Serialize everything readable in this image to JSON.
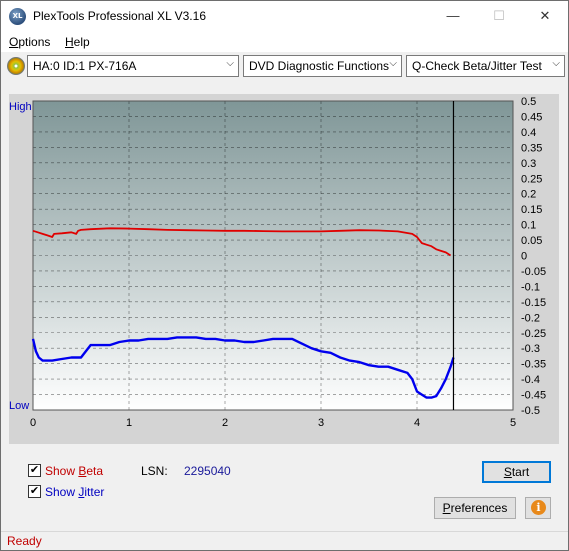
{
  "window": {
    "title": "PlexTools Professional XL V3.16",
    "icon_text": "XL",
    "minimize": "—",
    "maximize": "☐",
    "close": "✕"
  },
  "menu": [
    {
      "label": "Options",
      "accel": "O"
    },
    {
      "label": "Help",
      "accel": "H"
    }
  ],
  "toolbar": {
    "drive": "HA:0 ID:1  PX-716A",
    "function": "DVD Diagnostic Functions",
    "test": "Q-Check Beta/Jitter Test"
  },
  "chart_data": {
    "type": "line",
    "x_ticks": [
      "0",
      "1",
      "2",
      "3",
      "4",
      "5"
    ],
    "xlim": [
      0,
      5
    ],
    "left_labels": {
      "top": "High",
      "bottom": "Low"
    },
    "right_ticks": [
      "0.5",
      "0.45",
      "0.4",
      "0.35",
      "0.3",
      "0.25",
      "0.2",
      "0.15",
      "0.1",
      "0.05",
      "0",
      "-0.05",
      "-0.1",
      "-0.15",
      "-0.2",
      "-0.25",
      "-0.3",
      "-0.35",
      "-0.4",
      "-0.45",
      "-0.5"
    ],
    "ylim": [
      -0.5,
      0.5
    ],
    "cursor_x": 4.38,
    "colors": {
      "beta": "#e00000",
      "jitter": "#0000ee",
      "cursor": "#000000"
    },
    "series": [
      {
        "name": "Beta",
        "x": [
          0,
          0.05,
          0.1,
          0.15,
          0.2,
          0.22,
          0.3,
          0.4,
          0.45,
          0.47,
          0.5,
          0.6,
          0.8,
          1.0,
          1.2,
          1.4,
          1.6,
          1.8,
          2.0,
          2.2,
          2.4,
          2.6,
          2.8,
          3.0,
          3.2,
          3.4,
          3.6,
          3.8,
          3.95,
          4.0,
          4.05,
          4.1,
          4.15,
          4.2,
          4.25,
          4.3,
          4.35
        ],
        "values": [
          0.08,
          0.075,
          0.07,
          0.065,
          0.06,
          0.07,
          0.072,
          0.075,
          0.07,
          0.08,
          0.083,
          0.085,
          0.088,
          0.087,
          0.085,
          0.083,
          0.082,
          0.081,
          0.08,
          0.08,
          0.079,
          0.078,
          0.078,
          0.078,
          0.08,
          0.082,
          0.081,
          0.078,
          0.07,
          0.06,
          0.04,
          0.035,
          0.03,
          0.02,
          0.015,
          0.01,
          0.0
        ]
      },
      {
        "name": "Jitter",
        "x": [
          0,
          0.03,
          0.06,
          0.1,
          0.2,
          0.3,
          0.4,
          0.5,
          0.6,
          0.7,
          0.8,
          0.9,
          1.0,
          1.1,
          1.2,
          1.3,
          1.4,
          1.5,
          1.6,
          1.7,
          1.8,
          1.9,
          2.0,
          2.1,
          2.2,
          2.3,
          2.4,
          2.5,
          2.6,
          2.7,
          2.8,
          2.9,
          3.0,
          3.1,
          3.2,
          3.3,
          3.4,
          3.5,
          3.6,
          3.7,
          3.8,
          3.9,
          3.95,
          4.0,
          4.05,
          4.1,
          4.15,
          4.2,
          4.25,
          4.3,
          4.35,
          4.38
        ],
        "values": [
          -0.27,
          -0.31,
          -0.33,
          -0.34,
          -0.34,
          -0.335,
          -0.33,
          -0.33,
          -0.29,
          -0.29,
          -0.29,
          -0.28,
          -0.275,
          -0.275,
          -0.27,
          -0.27,
          -0.27,
          -0.265,
          -0.265,
          -0.265,
          -0.27,
          -0.27,
          -0.275,
          -0.275,
          -0.28,
          -0.28,
          -0.275,
          -0.27,
          -0.27,
          -0.27,
          -0.285,
          -0.3,
          -0.31,
          -0.315,
          -0.33,
          -0.34,
          -0.345,
          -0.355,
          -0.36,
          -0.36,
          -0.37,
          -0.38,
          -0.4,
          -0.44,
          -0.45,
          -0.46,
          -0.46,
          -0.455,
          -0.43,
          -0.4,
          -0.36,
          -0.33
        ]
      }
    ]
  },
  "bottom": {
    "show_beta": {
      "label": "Show Beta",
      "accel": "B",
      "checked": true,
      "color": "#c00000"
    },
    "show_jitter": {
      "label": "Show Jitter",
      "accel": "J",
      "checked": true,
      "color": "#0000c0"
    },
    "lsn_label": "LSN:",
    "lsn_value": "2295040",
    "start_label": "Start",
    "start_accel": "S",
    "preferences_label": "Preferences",
    "preferences_accel": "P",
    "info_icon": "i"
  },
  "status": {
    "text": "Ready"
  }
}
